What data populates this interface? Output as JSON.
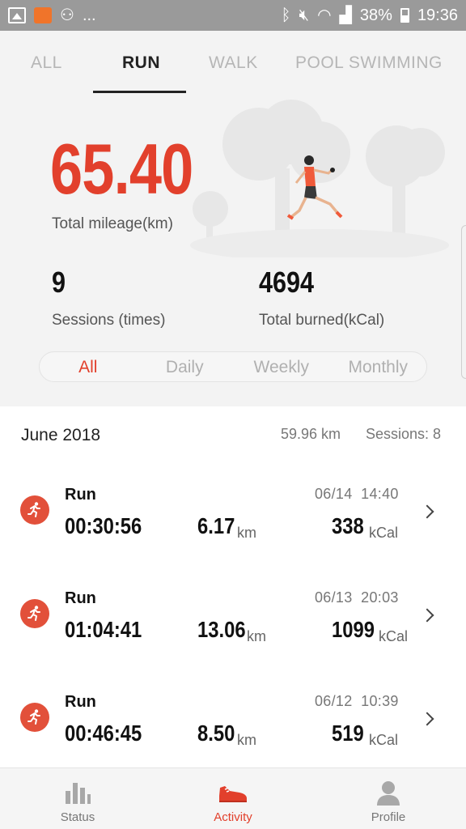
{
  "status_bar": {
    "left_icons": [
      "image-icon",
      "app-icon",
      "cast-icon"
    ],
    "more": "...",
    "battery_percent": "38%",
    "time": "19:36"
  },
  "tabs": [
    {
      "label": "ALL",
      "active": false
    },
    {
      "label": "RUN",
      "active": true
    },
    {
      "label": "WALK",
      "active": false
    },
    {
      "label": "POOL SWIMMING",
      "active": false
    }
  ],
  "summary": {
    "total_mileage": "65.40",
    "total_mileage_label": "Total mileage(km)",
    "sessions": "9",
    "sessions_label": "Sessions (times)",
    "total_burned": "4694",
    "total_burned_label": "Total burned(kCal)"
  },
  "period_filter": {
    "options": [
      "All",
      "Daily",
      "Weekly",
      "Monthly"
    ],
    "selected": "All"
  },
  "month_group": {
    "month": "June 2018",
    "distance": "59.96 km",
    "sessions": "Sessions: 8"
  },
  "activities": [
    {
      "type": "Run",
      "date": "06/14",
      "time": "14:40",
      "duration": "00:30:56",
      "distance": "6.17",
      "distance_unit": "km",
      "calories": "338",
      "calories_unit": "kCal"
    },
    {
      "type": "Run",
      "date": "06/13",
      "time": "20:03",
      "duration": "01:04:41",
      "distance": "13.06",
      "distance_unit": "km",
      "calories": "1099",
      "calories_unit": "kCal"
    },
    {
      "type": "Run",
      "date": "06/12",
      "time": "10:39",
      "duration": "00:46:45",
      "distance": "8.50",
      "distance_unit": "km",
      "calories": "519",
      "calories_unit": "kCal"
    }
  ],
  "bottom_nav": [
    {
      "label": "Status",
      "icon": "bar-chart-icon",
      "active": false
    },
    {
      "label": "Activity",
      "icon": "shoe-icon",
      "active": true
    },
    {
      "label": "Profile",
      "icon": "person-icon",
      "active": false
    }
  ],
  "colors": {
    "accent": "#e2402c",
    "status_bar": "#9a9a9a"
  }
}
